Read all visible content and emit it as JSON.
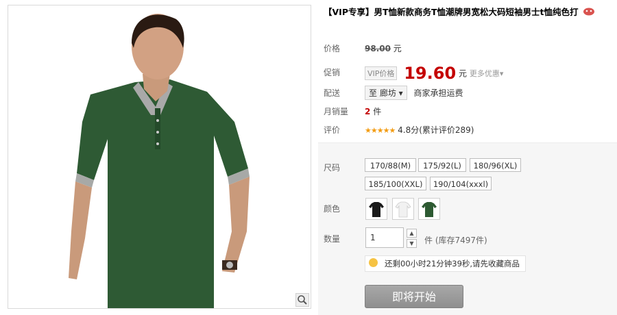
{
  "product": {
    "title": "【VIP专享】男T恤新款商务T恤潮牌男宽松大码短袖男士t恤纯色打",
    "price_label": "价格",
    "original_price": "98.00",
    "currency": "元",
    "promo_label": "促销",
    "vip_tag": "VIP价格",
    "promo_price": "19.60",
    "promo_currency": "元",
    "more_offers": "更多优惠▾",
    "shipping_label": "配送",
    "ship_to": "至 廊坊 ▾",
    "shipping_note": "商家承担运费",
    "monthly_sales_label": "月销量",
    "monthly_sales_value": "2",
    "monthly_sales_unit": "件",
    "rating_label": "评价",
    "rating_stars": "★★★★★",
    "rating_text": "4.8分(累计评价289)"
  },
  "options": {
    "size_label": "尺码",
    "sizes": [
      "170/88(M)",
      "175/92(L)",
      "180/96(XL)",
      "185/100(XXL)",
      "190/104(xxxl)"
    ],
    "color_label": "颜色",
    "colors": [
      "#1a1a1a",
      "#f4f4f4",
      "#2d5a32"
    ],
    "color_icons": [
      "black-polo-swatch-icon",
      "white-polo-swatch-icon",
      "green-polo-swatch-icon"
    ],
    "quantity_label": "数量",
    "quantity_value": "1",
    "stepper_up": "▲",
    "stepper_down": "▼",
    "stock_text": "件 (库存7497件)",
    "countdown_text": "还剩00小时21分钟39秒,请先收藏商品",
    "buy_button": "即将开始"
  },
  "colors": {
    "price_red": "#c40000",
    "shirt_green": "#2e5a34",
    "panel_bg": "#f6f6f6"
  },
  "icons": {
    "zoom": "magnifier-icon",
    "badge": "vip-badge-icon",
    "tip": "lightbulb-icon"
  }
}
